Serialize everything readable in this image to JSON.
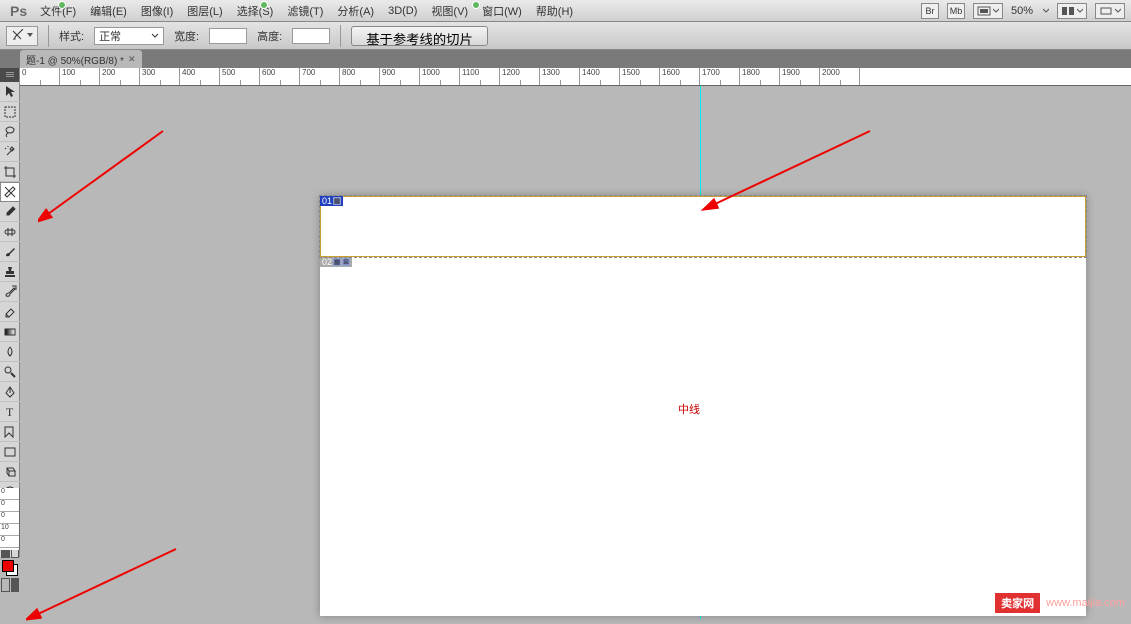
{
  "app": {
    "logo": "Ps"
  },
  "menu": {
    "items": [
      {
        "label": "文件(F)"
      },
      {
        "label": "编辑(E)"
      },
      {
        "label": "图像(I)"
      },
      {
        "label": "图层(L)"
      },
      {
        "label": "选择(S)"
      },
      {
        "label": "滤镜(T)"
      },
      {
        "label": "分析(A)"
      },
      {
        "label": "3D(D)"
      },
      {
        "label": "视图(V)"
      },
      {
        "label": "窗口(W)"
      },
      {
        "label": "帮助(H)"
      }
    ],
    "zoom": "50%",
    "br": "Br",
    "mb": "Mb"
  },
  "options": {
    "style_label": "样式:",
    "style_value": "正常",
    "width_label": "宽度:",
    "height_label": "高度:",
    "button": "基于参考线的切片"
  },
  "tab": {
    "title": "题-1 @ 50%(RGB/8) *"
  },
  "ruler": {
    "h": [
      "700",
      "600",
      "500",
      "400",
      "300",
      "200",
      "100",
      "0",
      "100",
      "200",
      "300",
      "400",
      "500",
      "600",
      "700",
      "800",
      "900",
      "1000",
      "1100",
      "1200",
      "1300",
      "1400",
      "1500",
      "1600",
      "1700",
      "1800",
      "1900",
      "2000"
    ],
    "v": [
      "0",
      "0",
      "0",
      "10",
      "0"
    ]
  },
  "slices": {
    "s1": "01",
    "s2": "02"
  },
  "guide": {
    "label": "中线"
  },
  "watermark": {
    "badge": "卖家网",
    "url": "www.maijia.com"
  },
  "colors": {
    "fg": "#e00000",
    "bg": "#ffffff",
    "guide": "#00eaff",
    "accent": "#2040c0"
  },
  "tools": [
    {
      "n": "move-tool"
    },
    {
      "n": "marquee-tool"
    },
    {
      "n": "lasso-tool"
    },
    {
      "n": "wand-tool"
    },
    {
      "n": "crop-tool"
    },
    {
      "n": "slice-tool"
    },
    {
      "n": "eyedropper-tool"
    },
    {
      "n": "healing-tool"
    },
    {
      "n": "brush-tool"
    },
    {
      "n": "stamp-tool"
    },
    {
      "n": "history-brush-tool"
    },
    {
      "n": "eraser-tool"
    },
    {
      "n": "gradient-tool"
    },
    {
      "n": "blur-tool"
    },
    {
      "n": "dodge-tool"
    },
    {
      "n": "pen-tool"
    },
    {
      "n": "type-tool"
    },
    {
      "n": "path-tool"
    },
    {
      "n": "shape-tool"
    },
    {
      "n": "3d-tool"
    },
    {
      "n": "3d-cam-tool"
    },
    {
      "n": "hand-tool"
    },
    {
      "n": "zoom-tool"
    }
  ]
}
